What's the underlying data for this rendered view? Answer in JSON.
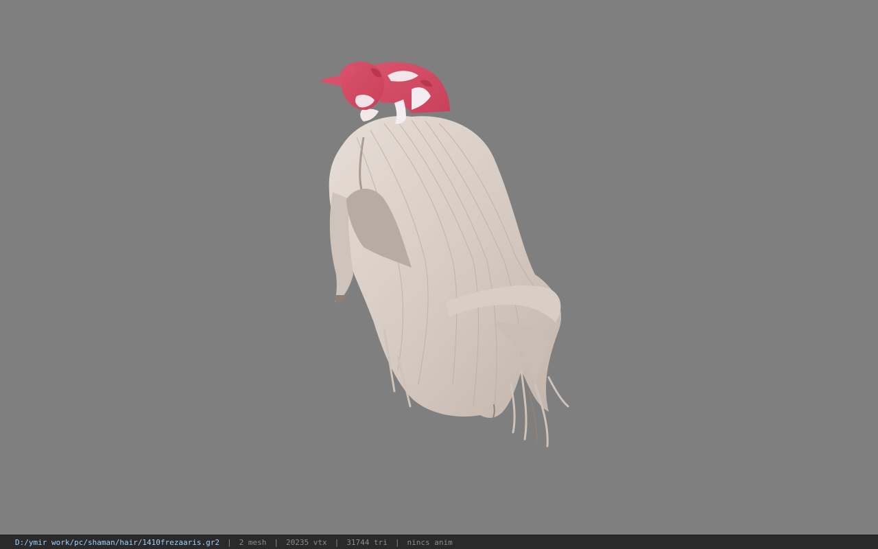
{
  "viewport": {
    "background_color": "#7f7f7f",
    "model_icon": "hair-with-cat-model"
  },
  "statusbar": {
    "file_path": "D:/ymir work/pc/shaman/hair/1410frezaaris.gr2",
    "separator": "|",
    "mesh_count": "2 mesh",
    "vertex_count": "20235 vtx",
    "triangle_count": "31744 tri",
    "anim_status": "nincs anim",
    "path_color": "#9fd3ff",
    "text_color": "#8c8c8c"
  }
}
